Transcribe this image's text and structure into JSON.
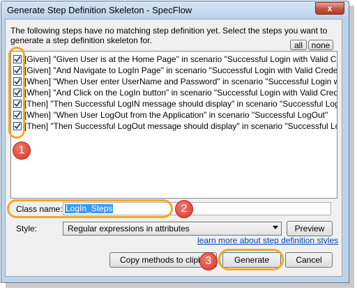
{
  "window": {
    "title": "Generate Step Definition Skeleton - SpecFlow",
    "close_glyph": "x"
  },
  "instructions": "The following steps have no matching step definition yet. Select the steps you want to generate a step definition skeleton for.",
  "buttons": {
    "all": "all",
    "none": "none",
    "preview": "Preview",
    "copy": "Copy methods to clipbo",
    "generate": "Generate",
    "cancel": "Cancel"
  },
  "steps": [
    {
      "checked": true,
      "text": "[Given] \"Given User is at the Home Page\" in scenario \"Successful Login with Valid Credenti"
    },
    {
      "checked": true,
      "text": "[Given] \"And Navigate to LogIn Page\" in scenario \"Successful Login with Valid Credentials\""
    },
    {
      "checked": true,
      "text": "[When] \"When User enter UserName and Password\" in scenario \"Successful Login with Va"
    },
    {
      "checked": true,
      "text": "[When] \"And Click on the LogIn button\" in scenario \"Successful Login with Valid Credentials"
    },
    {
      "checked": true,
      "text": "[Then] \"Then Successful LogIN message should display\" in scenario \"Successful Login with"
    },
    {
      "checked": true,
      "text": "[When] \"When User LogOut from the Application\" in scenario \"Successful LogOut\""
    },
    {
      "checked": true,
      "text": "[Then] \"Then Successful LogOut message should display\" in scenario \"Successful LogOut\""
    }
  ],
  "class_name": {
    "label": "Class name:",
    "value": "LogIn_Steps"
  },
  "style": {
    "label": "Style:",
    "value": "Regular expressions in attributes"
  },
  "link": "learn more about step definition styles",
  "annotations": [
    "1",
    "2",
    "3"
  ],
  "colors": {
    "callout": "#f5a623",
    "badge": "#d9352a",
    "selection": "#3399ff",
    "link": "#0645ad"
  }
}
